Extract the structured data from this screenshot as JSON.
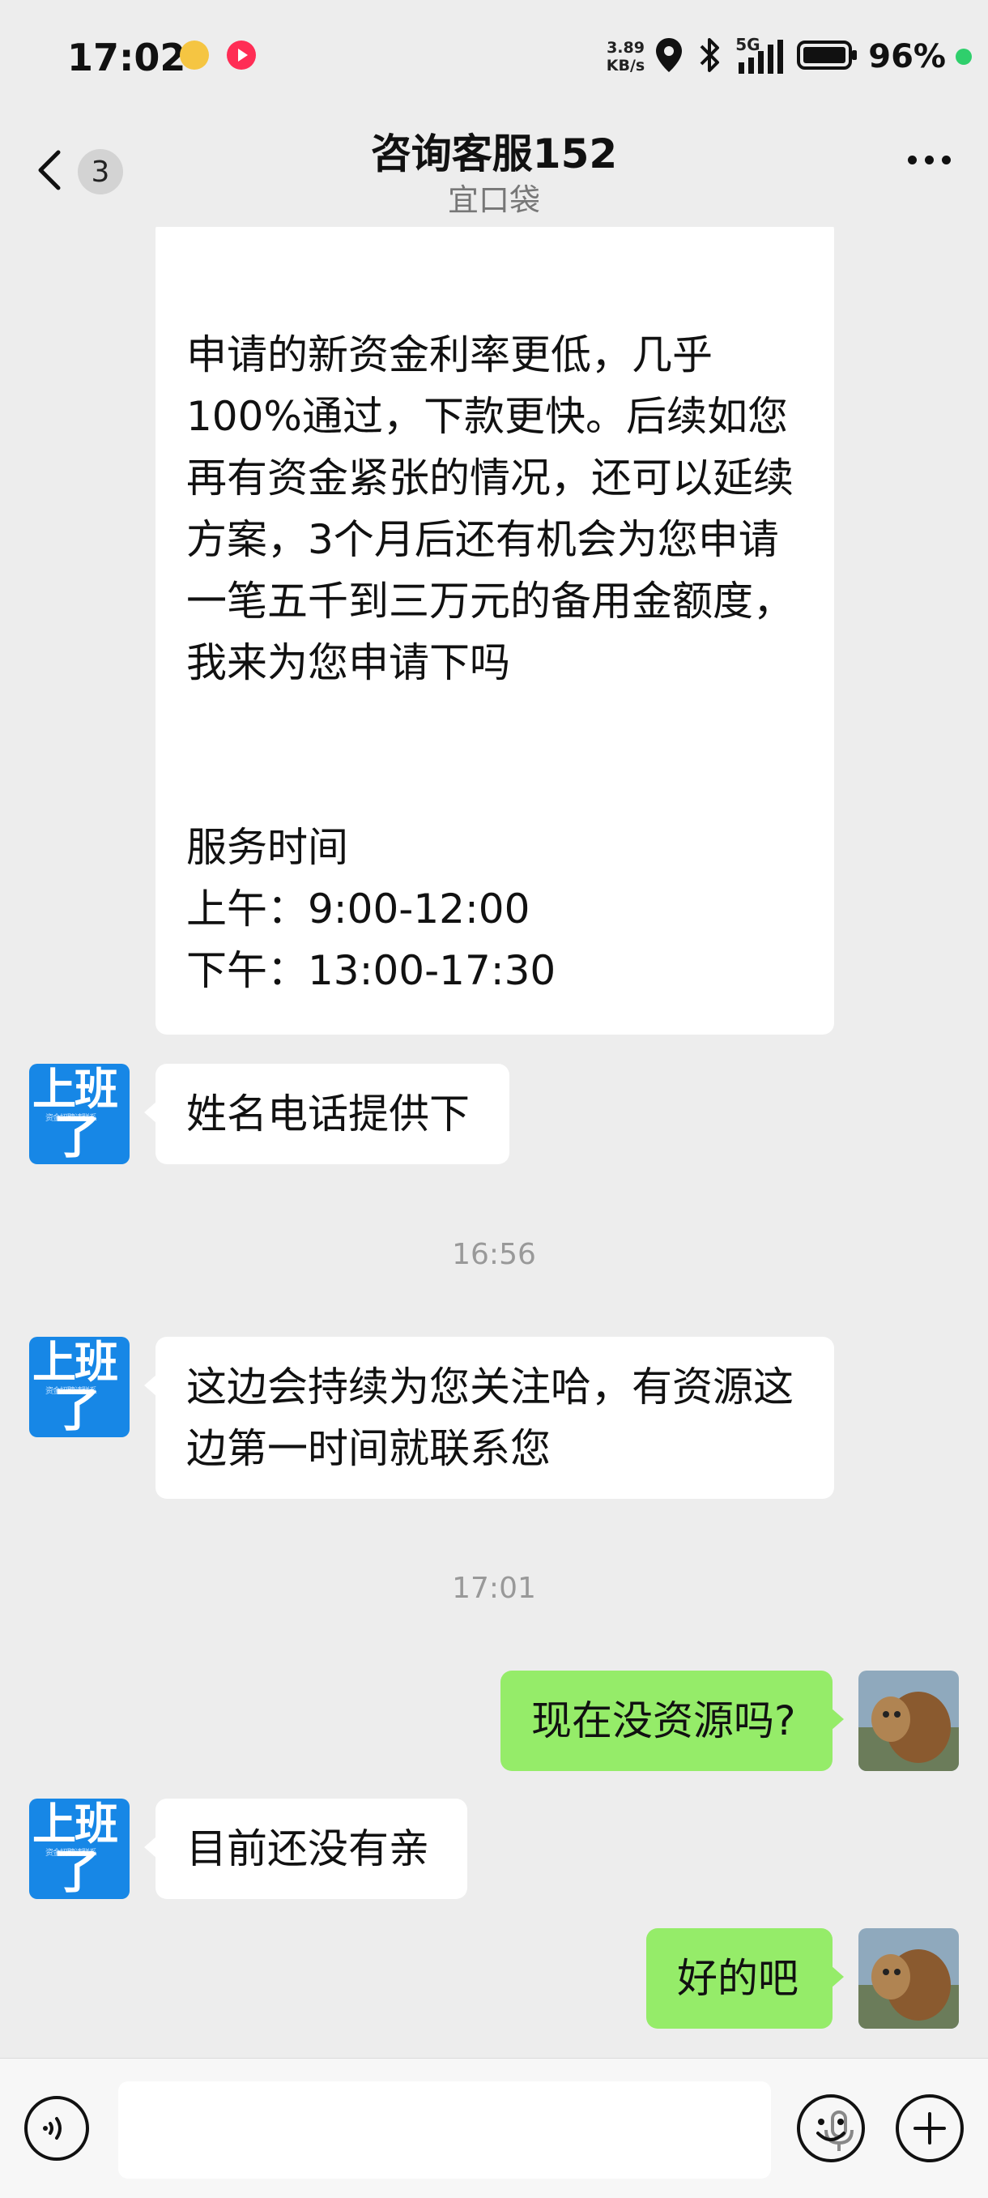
{
  "status_bar": {
    "time": "17:02",
    "net_speed_value": "3.89",
    "net_speed_unit": "KB/s",
    "network": "5G",
    "battery": "96%",
    "icons": [
      "notification-app-icon",
      "video-app-icon",
      "location-icon",
      "bluetooth-icon",
      "signal-icon",
      "battery-icon"
    ]
  },
  "nav": {
    "back_badge": "3",
    "title": "咨询客服152",
    "subtitle": "宜口袋"
  },
  "avatar": {
    "cs_line1": "上班",
    "cs_line2": "了",
    "cs_small": "资金招聘请联系"
  },
  "messages": {
    "m1": {
      "sender": "customer-service",
      "lines": [
        "申请的新资金利率更低，几乎",
        "100%通过，下款更快。后续如您",
        "再有资金紧张的情况，还可以延续",
        "方案，3个月后还有机会为您申请",
        "一笔五千到三万元的备用金额度，",
        "我来为您申请下吗"
      ],
      "service_title": "服务时间",
      "service_am": "上午：9:00-12:00",
      "service_pm": "下午：13:00-17:30"
    },
    "m2": {
      "sender": "customer-service",
      "text": "姓名电话提供下"
    },
    "t1": "16:56",
    "m3": {
      "sender": "customer-service",
      "line1": "这边会持续为您关注哈，有资源这",
      "line2": "边第一时间就联系您"
    },
    "t2": "17:01",
    "m4": {
      "sender": "me",
      "text": "现在没资源吗?"
    },
    "m5": {
      "sender": "customer-service",
      "text": "目前还没有亲"
    },
    "m6": {
      "sender": "me",
      "text": "好的吧"
    }
  },
  "input_bar": {
    "icons": [
      "voice-icon",
      "microphone-icon",
      "emoji-icon",
      "plus-icon"
    ]
  }
}
